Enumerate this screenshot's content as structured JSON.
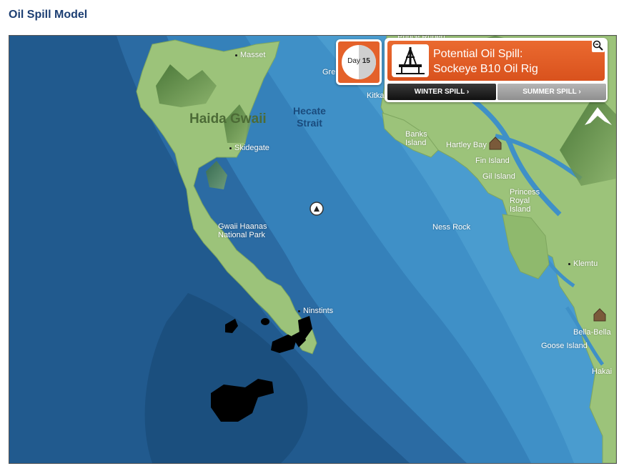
{
  "page": {
    "title": "Oil Spill Model"
  },
  "overlay": {
    "day_prefix": "Day",
    "day_number": "15",
    "day_progress": 0.5,
    "spill_title_line1": "Potential Oil Spill:",
    "spill_title_line2": "Sockeye B10 Oil Rig",
    "winter_button": "WINTER SPILL",
    "summer_button": "SUMMER SPILL",
    "accent_color": "#e4612a"
  },
  "map": {
    "island_name": "Haida Gwaii",
    "strait_name": "Hecate Strait",
    "places": {
      "masset": "Masset",
      "skidegate": "Skidegate",
      "gwaii_haanas": "Gwaii Haanas National Park",
      "ninstints": "Ninstints",
      "banks_island": "Banks Island",
      "hartley_bay": "Hartley Bay",
      "fin_island": "Fin Island",
      "gil_island": "Gil Island",
      "princess_royal": "Princess Royal Island",
      "ness_rock": "Ness Rock",
      "klemtu": "Klemtu",
      "bella_bella": "Bella-Bella",
      "goose_island": "Goose Island",
      "hakai": "Hakai",
      "prince_rupert_partial": "Prince Rupert",
      "grenville_partial": "Gre",
      "kitkatla_partial": "Kitka"
    },
    "colors": {
      "ocean_deep": "#215a8e",
      "ocean_mid": "#2f74ab",
      "ocean_shelf": "#3f8fc4",
      "land": "#9cc37a",
      "oil": "#000000"
    }
  }
}
